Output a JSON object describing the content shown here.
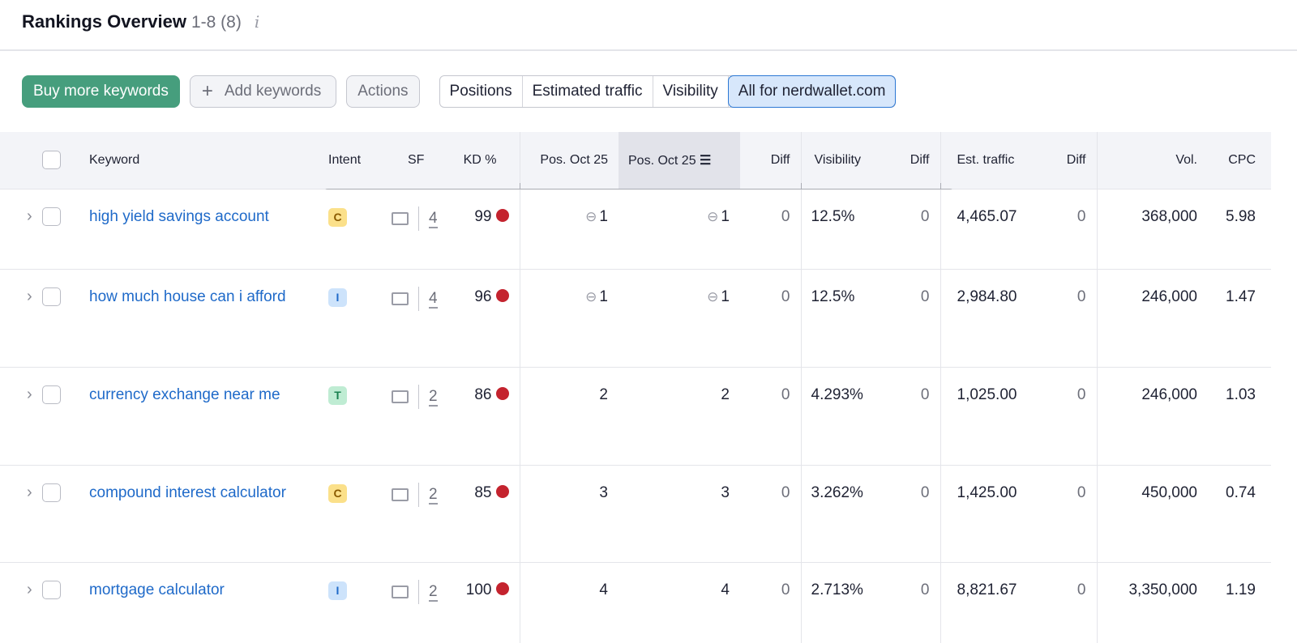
{
  "header": {
    "title": "Rankings Overview",
    "count": "1-8 (8)",
    "info_icon": "i"
  },
  "toolbar": {
    "buy": "Buy more keywords",
    "add": "Add keywords",
    "add_icon": "+",
    "actions": "Actions",
    "views": [
      "Positions",
      "Estimated traffic",
      "Visibility",
      "All for nerdwallet.com"
    ],
    "active_view": "All for nerdwallet.com"
  },
  "columns": {
    "keyword": "Keyword",
    "intent": "Intent",
    "sf": "SF",
    "kd": "KD %",
    "pos1": "Pos. Oct 25",
    "pos2": "Pos. Oct 25",
    "diff1": "Diff",
    "visibility": "Visibility",
    "diff2": "Diff",
    "traffic": "Est. traffic",
    "diff3": "Diff",
    "vol": "Vol.",
    "cpc": "CPC"
  },
  "rows": [
    {
      "keyword": "high yield savings account",
      "intent": "C",
      "sf": "4",
      "kd": "99",
      "pos1": "1",
      "pos2": "1",
      "diff1": "0",
      "visibility": "12.5%",
      "diff2": "0",
      "traffic": "4,465.07",
      "diff3": "0",
      "vol": "368,000",
      "cpc": "5.98",
      "link": true
    },
    {
      "keyword": "how much house can i afford",
      "intent": "I",
      "sf": "4",
      "kd": "96",
      "pos1": "1",
      "pos2": "1",
      "diff1": "0",
      "visibility": "12.5%",
      "diff2": "0",
      "traffic": "2,984.80",
      "diff3": "0",
      "vol": "246,000",
      "cpc": "1.47",
      "link": true
    },
    {
      "keyword": "currency exchange near me",
      "intent": "T",
      "sf": "2",
      "kd": "86",
      "pos1": "2",
      "pos2": "2",
      "diff1": "0",
      "visibility": "4.293%",
      "diff2": "0",
      "traffic": "1,025.00",
      "diff3": "0",
      "vol": "246,000",
      "cpc": "1.03",
      "link": false
    },
    {
      "keyword": "compound interest calculator",
      "intent": "C",
      "sf": "2",
      "kd": "85",
      "pos1": "3",
      "pos2": "3",
      "diff1": "0",
      "visibility": "3.262%",
      "diff2": "0",
      "traffic": "1,425.00",
      "diff3": "0",
      "vol": "450,000",
      "cpc": "0.74",
      "link": false
    },
    {
      "keyword": "mortgage calculator",
      "intent": "I",
      "sf": "2",
      "kd": "100",
      "pos1": "4",
      "pos2": "4",
      "diff1": "0",
      "visibility": "2.713%",
      "diff2": "0",
      "traffic": "8,821.67",
      "diff3": "0",
      "vol": "3,350,000",
      "cpc": "1.19",
      "link": false
    }
  ],
  "intent_colors": {
    "C": [
      "#fbe08a",
      "#8a5a00"
    ],
    "I": [
      "#cde3fb",
      "#1f6ac9"
    ],
    "T": [
      "#bfecd3",
      "#1a8150"
    ]
  },
  "kd_color": "#c4232e"
}
